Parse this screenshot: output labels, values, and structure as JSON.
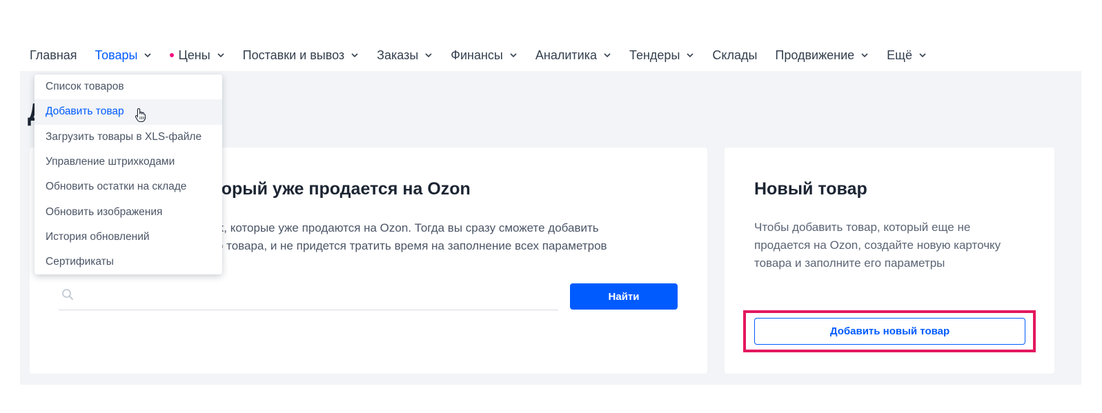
{
  "nav": {
    "items": [
      {
        "label": "Главная",
        "chevron": false,
        "dot": false,
        "active": false
      },
      {
        "label": "Товары",
        "chevron": true,
        "dot": false,
        "active": true
      },
      {
        "label": "Цены",
        "chevron": true,
        "dot": true,
        "active": false
      },
      {
        "label": "Поставки и вывоз",
        "chevron": true,
        "dot": false,
        "active": false
      },
      {
        "label": "Заказы",
        "chevron": true,
        "dot": false,
        "active": false
      },
      {
        "label": "Финансы",
        "chevron": true,
        "dot": false,
        "active": false
      },
      {
        "label": "Аналитика",
        "chevron": true,
        "dot": false,
        "active": false
      },
      {
        "label": "Тендеры",
        "chevron": true,
        "dot": false,
        "active": false
      },
      {
        "label": "Склады",
        "chevron": false,
        "dot": false,
        "active": false
      },
      {
        "label": "Продвижение",
        "chevron": true,
        "dot": false,
        "active": false
      },
      {
        "label": "Ещё",
        "chevron": true,
        "dot": false,
        "active": false
      }
    ]
  },
  "dropdown": {
    "items": [
      {
        "label": "Список товаров"
      },
      {
        "label": "Добавить товар"
      },
      {
        "label": "Загрузить товары в XLS-файле"
      },
      {
        "label": "Управление штрихкодами"
      },
      {
        "label": "Обновить остатки на складе"
      },
      {
        "label": "Обновить изображения"
      },
      {
        "label": "История обновлений"
      },
      {
        "label": "Сертификаты"
      }
    ]
  },
  "page": {
    "title": "Д"
  },
  "left_card": {
    "title": "Найдите товар, который уже продается на Ozon",
    "desc_line1": "Найдите свой товар среди тех, которые уже продаются на Ozon. Тогда вы сразу сможете добавить",
    "desc_line2": "предложение о продаже этого товара, и не придется тратить время на заполнение всех параметров",
    "search_value": "",
    "find_label": "Найти"
  },
  "right_card": {
    "title": "Новый товар",
    "desc": "Чтобы добавить товар, который еще не продается на Ozon, создайте новую карточку товара и заполните его параметры",
    "add_label": "Добавить новый товар"
  },
  "colors": {
    "accent": "#005bff",
    "highlight": "#e3185f",
    "dot": "#f1117e"
  }
}
